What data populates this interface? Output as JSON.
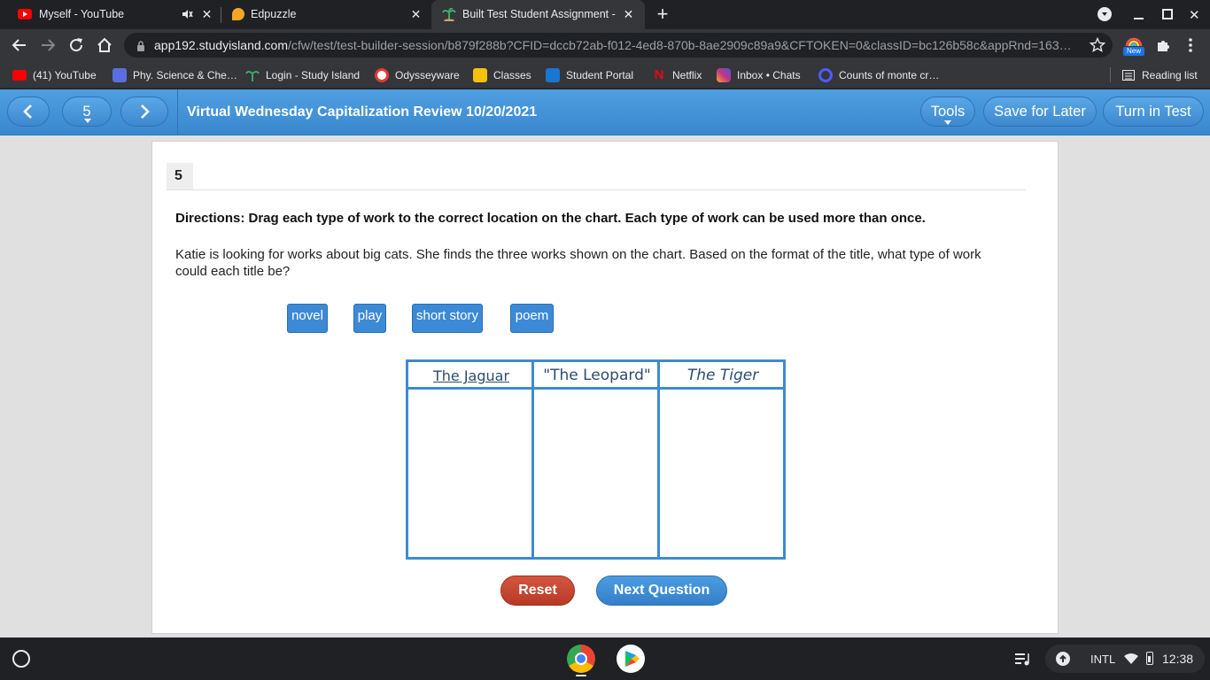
{
  "browser": {
    "tabs": [
      {
        "title": "Myself - YouTube",
        "favicon": "youtube-icon",
        "muted": true
      },
      {
        "title": "Edpuzzle",
        "favicon": "edpuzzle-icon"
      },
      {
        "title": "Built Test Student Assignment - S",
        "favicon": "studyisland-icon",
        "active": true
      }
    ],
    "url_host": "app192.studyisland.com",
    "url_path": "/cfw/test/test-builder-session/b879f288b?CFID=dccb72ab-f012-4ed8-870b-8ae2909c89a9&CFTOKEN=0&classID=bc126b58c&appRnd=163…",
    "extension_badge": "New",
    "bookmarks": [
      {
        "label": "(41) YouTube",
        "color": "#ff0000"
      },
      {
        "label": "Phy. Science & Che…",
        "color": "#5b6ee1"
      },
      {
        "label": "Login - Study Island",
        "color": "#3cb371"
      },
      {
        "label": "Odysseyware",
        "color": "#e53935"
      },
      {
        "label": "Classes",
        "color": "#f4c20d"
      },
      {
        "label": "Student Portal",
        "color": "#1976d2"
      },
      {
        "label": "Netflix",
        "color": "#e50914"
      },
      {
        "label": "Inbox • Chats",
        "color": "#c13584"
      },
      {
        "label": "Counts of monte cr…",
        "color": "#4f5bff"
      }
    ],
    "reading_list": "Reading list"
  },
  "app": {
    "question_number": "5",
    "title": "Virtual Wednesday Capitalization Review 10/20/2021",
    "tools_label": "Tools",
    "save_label": "Save for Later",
    "turnin_label": "Turn in Test"
  },
  "question": {
    "number": "5",
    "directions": "Directions: Drag each type of work to the correct location on the chart. Each type of work can be used more than once.",
    "prompt": "Katie is looking for works about big cats. She finds the three works shown on the chart. Based on the format of the title, what type of work could each title be?",
    "choices": [
      "novel",
      "play",
      "short story",
      "poem"
    ],
    "columns": [
      "The Jaguar",
      "\"The Leopard\"",
      "The Tiger"
    ],
    "reset_label": "Reset",
    "next_label": "Next Question"
  },
  "shelf": {
    "ime": "INTL",
    "time": "12:38"
  }
}
